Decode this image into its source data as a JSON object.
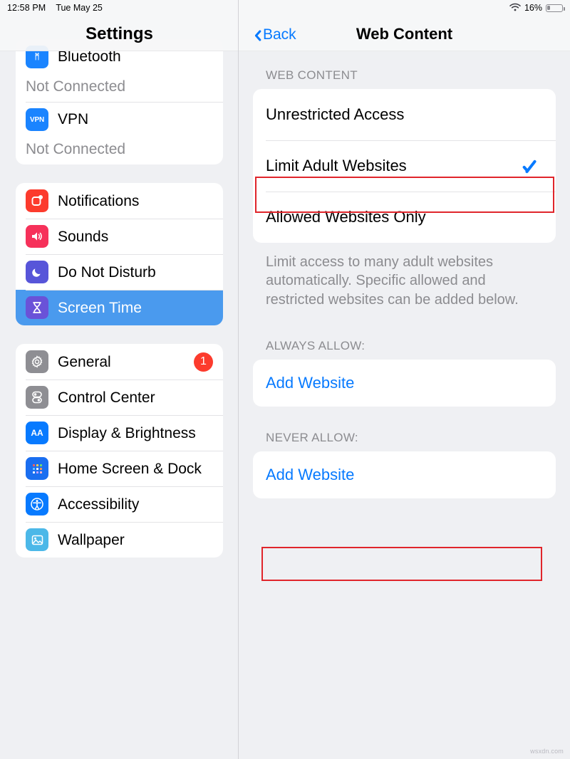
{
  "status_bar": {
    "time": "12:58 PM",
    "date": "Tue May 25",
    "wifi_icon": "wifi-icon",
    "battery_percent": "16%",
    "battery_icon": "battery-icon"
  },
  "sidebar": {
    "title": "Settings",
    "groups": [
      {
        "items": [
          {
            "label": "Bluetooth",
            "sub": "Not Connected",
            "icon": "bluetooth-icon",
            "icon_glyph": "ᛗ",
            "icon_class": "bt-ic",
            "selected": false,
            "badge": ""
          },
          {
            "label": "VPN",
            "sub": "Not Connected",
            "icon": "vpn-icon",
            "icon_glyph": "VPN",
            "icon_class": "vpn-ic",
            "selected": false,
            "badge": ""
          }
        ]
      },
      {
        "items": [
          {
            "label": "Notifications",
            "sub": "",
            "icon": "notifications-icon",
            "icon_glyph": "▢",
            "icon_class": "notif-ic",
            "selected": false,
            "badge": ""
          },
          {
            "label": "Sounds",
            "sub": "",
            "icon": "sounds-icon",
            "icon_glyph": "🔊",
            "icon_class": "sound-ic",
            "selected": false,
            "badge": ""
          },
          {
            "label": "Do Not Disturb",
            "sub": "",
            "icon": "moon-icon",
            "icon_glyph": "☾",
            "icon_class": "dnd-ic",
            "selected": false,
            "badge": ""
          },
          {
            "label": "Screen Time",
            "sub": "",
            "icon": "hourglass-icon",
            "icon_glyph": "⌛",
            "icon_class": "st-ic",
            "selected": true,
            "badge": ""
          }
        ]
      },
      {
        "items": [
          {
            "label": "General",
            "sub": "",
            "icon": "gear-icon",
            "icon_glyph": "⚙",
            "icon_class": "gen-ic",
            "selected": false,
            "badge": "1"
          },
          {
            "label": "Control Center",
            "sub": "",
            "icon": "control-center-icon",
            "icon_glyph": "≡",
            "icon_class": "cc-ic",
            "selected": false,
            "badge": ""
          },
          {
            "label": "Display & Brightness",
            "sub": "",
            "icon": "display-brightness-icon",
            "icon_glyph": "AA",
            "icon_class": "disp-ic",
            "selected": false,
            "badge": ""
          },
          {
            "label": "Home Screen & Dock",
            "sub": "",
            "icon": "home-screen-icon",
            "icon_glyph": "☷",
            "icon_class": "home-ic",
            "selected": false,
            "badge": ""
          },
          {
            "label": "Accessibility",
            "sub": "",
            "icon": "accessibility-icon",
            "icon_glyph": "ⓞ",
            "icon_class": "acc-ic",
            "selected": false,
            "badge": ""
          },
          {
            "label": "Wallpaper",
            "sub": "",
            "icon": "wallpaper-icon",
            "icon_glyph": "◰",
            "icon_class": "wall-ic",
            "selected": false,
            "badge": ""
          }
        ]
      }
    ]
  },
  "main": {
    "back_label": "Back",
    "back_icon": "chevron-left-icon",
    "title": "Web Content",
    "section_web_content": {
      "header": "WEB CONTENT",
      "options": [
        {
          "label": "Unrestricted Access",
          "checked": false
        },
        {
          "label": "Limit Adult Websites",
          "checked": true
        },
        {
          "label": "Allowed Websites Only",
          "checked": false
        }
      ],
      "description": "Limit access to many adult websites automatically. Specific allowed and restricted websites can be added below."
    },
    "section_always_allow": {
      "header": "ALWAYS ALLOW:",
      "add_label": "Add Website"
    },
    "section_never_allow": {
      "header": "NEVER ALLOW:",
      "add_label": "Add Website"
    }
  },
  "annotations": {
    "color": "#e0252b",
    "boxes": [
      "limit-adult-websites-row",
      "never-allow-add-website"
    ]
  },
  "watermark": "wsxdn.com"
}
